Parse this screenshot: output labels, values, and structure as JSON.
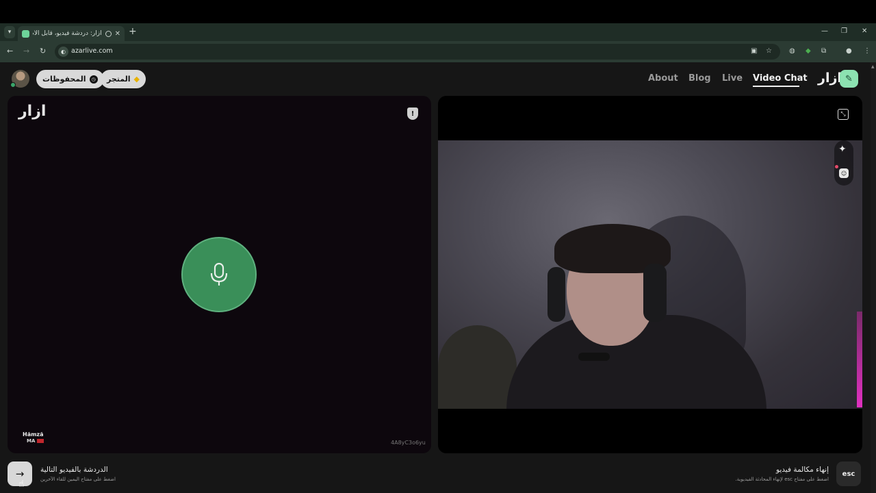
{
  "browser": {
    "tab_title": "أزار: دردشة فيديو، قابل الأصد",
    "url": "azarlive.com",
    "new_tab_symbol": "+",
    "tab_close_symbol": "✕",
    "window_controls": [
      "—",
      "❐",
      "✕"
    ]
  },
  "header": {
    "brand": "ازار",
    "nav": [
      {
        "label": "Video Chat",
        "active": true
      },
      {
        "label": "Live",
        "active": false
      },
      {
        "label": "Blog",
        "active": false
      },
      {
        "label": "About",
        "active": false
      }
    ],
    "shop_label": "المتجر",
    "saved_label": "المحفوظات"
  },
  "call": {
    "watermark": "ازار",
    "peer_name": "Hămză",
    "peer_country": "MA",
    "call_id": "4A8yC3o6yu",
    "mic_state": "active"
  },
  "footer": {
    "next_title": "الدردشة بالفيديو التالية",
    "next_hint": "اضغط على مفتاح اليمين للقاء الآخرين",
    "esc_label": "esc",
    "end_title": "إنهاء مكالمة فيديو",
    "end_hint": "اضغط على مفتاح esc لإنهاء المحادثة الفيديوية."
  },
  "colors": {
    "accent_green": "#3a8f59",
    "brand_mint": "#8ce2b1",
    "gem_gold": "#e8b200",
    "browser_frame": "#2b3b33"
  },
  "icons": {
    "mic": "microphone-icon",
    "shield": "report-shield-icon",
    "exit_fullscreen": "exit-fullscreen-icon",
    "effects": "sparkle-icon",
    "filters": "face-filter-icon",
    "next": "arrow-right-icon",
    "history": "clock-icon",
    "shop": "gem-icon"
  }
}
